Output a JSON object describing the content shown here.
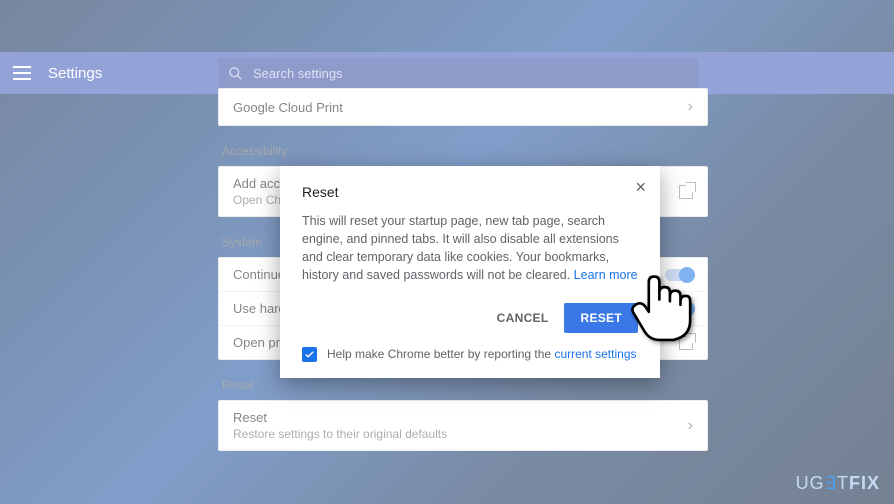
{
  "header": {
    "title": "Settings",
    "search_placeholder": "Search settings"
  },
  "sections": {
    "gcp": {
      "label": "Google Cloud Print"
    },
    "accessibility": {
      "heading": "Accessibility",
      "title": "Add accessibility features",
      "sub": "Open Chrome Web Store"
    },
    "system": {
      "heading": "System",
      "row1": "Continue running background apps when Google Chrome is closed",
      "row2": "Use hardware acceleration when available",
      "row3": "Open proxy settings"
    },
    "reset": {
      "heading": "Reset",
      "title": "Reset",
      "sub": "Restore settings to their original defaults"
    }
  },
  "modal": {
    "title": "Reset",
    "body": "This will reset your startup page, new tab page, search engine, and pinned tabs. It will also disable all extensions and clear temporary data like cookies. Your bookmarks, history and saved passwords will not be cleared. ",
    "learn_more": "Learn more",
    "cancel": "CANCEL",
    "reset": "RESET",
    "help_prefix": "Help make Chrome better by reporting the ",
    "help_link": "current settings"
  },
  "watermark": "UGETFIX"
}
